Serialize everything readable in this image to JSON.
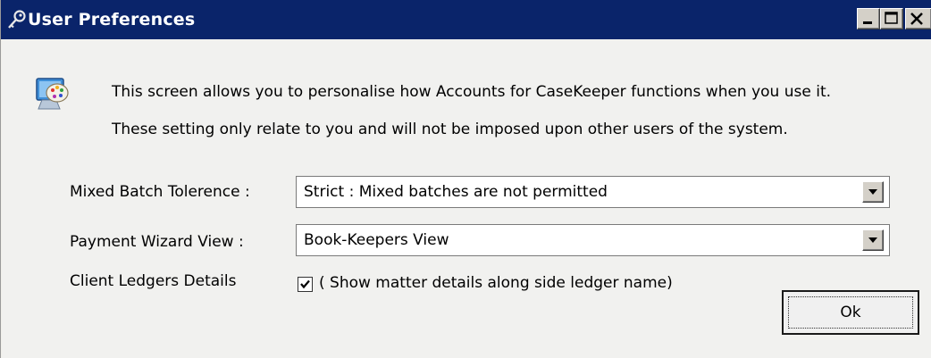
{
  "window": {
    "title": "User Preferences",
    "colors": {
      "titlebar": "#0a246a",
      "title_text": "#ffffff",
      "client": "#f1f1ef"
    }
  },
  "info": {
    "line1": "This screen allows you to personalise how Accounts for CaseKeeper functions when you use it.",
    "line2": "These setting only relate to you and will not be imposed upon other users of the system."
  },
  "form": {
    "mixed_batch": {
      "label": "Mixed Batch Tolerence :",
      "value": "Strict : Mixed batches are not permitted"
    },
    "payment_wizard": {
      "label": "Payment Wizard View :",
      "value": "Book-Keepers View"
    },
    "client_ledgers": {
      "label": "Client Ledgers Details",
      "checked": true,
      "checkbox_text": "( Show matter details along side ledger name)"
    }
  },
  "buttons": {
    "ok": "Ok"
  },
  "icons": {
    "title": "key-icon",
    "info": "display-settings-icon",
    "minimize": "minimize-icon",
    "maximize": "maximize-icon",
    "close": "close-icon",
    "dropdown": "chevron-down-icon",
    "check": "checkmark-icon"
  }
}
